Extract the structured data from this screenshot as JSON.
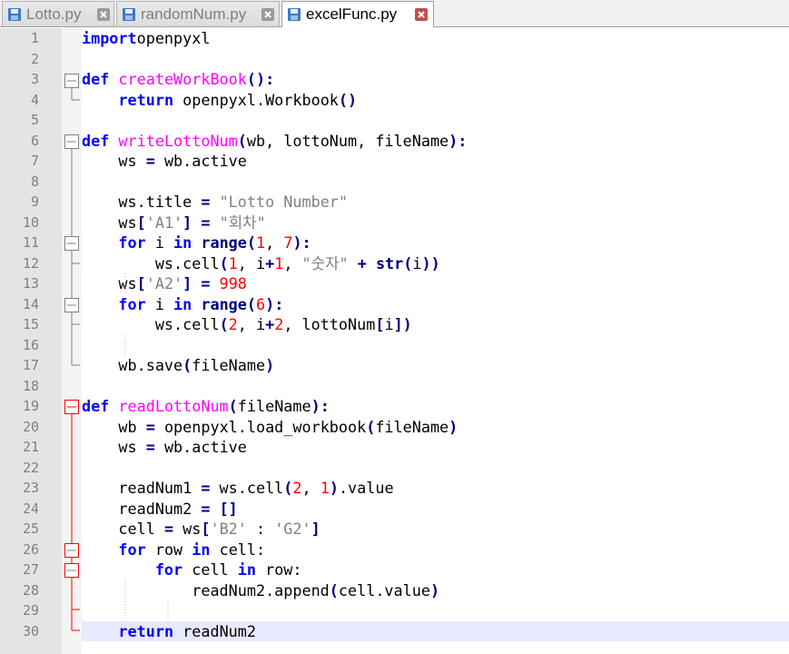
{
  "tabs": [
    {
      "label": "Lotto.py",
      "active": false
    },
    {
      "label": "randomNum.py",
      "active": false
    },
    {
      "label": "excelFunc.py",
      "active": true
    }
  ],
  "colors": {
    "keyword": "#0000ff",
    "function_name": "#ff00ff",
    "builtin": "#000080",
    "number": "#ff0000",
    "string": "#808080",
    "fold_active": "#ff0000",
    "current_line": "#e8e8ff"
  },
  "icons": {
    "tab_save": "floppy-disk-icon",
    "tab_close": "close-icon"
  },
  "editor": {
    "current_line": 30,
    "lines": [
      {
        "n": "1",
        "tokens": [
          [
            "kw",
            "import"
          ],
          [
            "",
            "openpyxl"
          ]
        ]
      },
      {
        "n": "2",
        "tokens": []
      },
      {
        "n": "3",
        "tokens": [
          [
            "kw",
            "def"
          ],
          [
            "",
            " "
          ],
          [
            "fn",
            "createWorkBook"
          ],
          [
            "op",
            "():"
          ]
        ]
      },
      {
        "n": "4",
        "tokens": [
          [
            "",
            "    "
          ],
          [
            "kw",
            "return"
          ],
          [
            "",
            " openpyxl.Workbook"
          ],
          [
            "op",
            "()"
          ]
        ]
      },
      {
        "n": "5",
        "tokens": []
      },
      {
        "n": "6",
        "tokens": [
          [
            "kw",
            "def"
          ],
          [
            "",
            " "
          ],
          [
            "fn",
            "writeLottoNum"
          ],
          [
            "op",
            "("
          ],
          [
            "",
            "wb, lottoNum, fileName"
          ],
          [
            "op",
            "):"
          ]
        ]
      },
      {
        "n": "7",
        "tokens": [
          [
            "",
            "    ws "
          ],
          [
            "op",
            "="
          ],
          [
            "",
            " wb.active"
          ]
        ]
      },
      {
        "n": "8",
        "tokens": []
      },
      {
        "n": "9",
        "tokens": [
          [
            "",
            "    ws.title "
          ],
          [
            "op",
            "="
          ],
          [
            "",
            " "
          ],
          [
            "str",
            "\"Lotto Number\""
          ]
        ]
      },
      {
        "n": "10",
        "tokens": [
          [
            "",
            "    ws"
          ],
          [
            "op",
            "["
          ],
          [
            "str",
            "'A1'"
          ],
          [
            "op",
            "]"
          ],
          [
            "",
            " "
          ],
          [
            "op",
            "="
          ],
          [
            "",
            " "
          ],
          [
            "str",
            "\"회차\""
          ]
        ]
      },
      {
        "n": "11",
        "tokens": [
          [
            "",
            "    "
          ],
          [
            "kw",
            "for"
          ],
          [
            "",
            " i "
          ],
          [
            "kw",
            "in"
          ],
          [
            "",
            " "
          ],
          [
            "bi",
            "range"
          ],
          [
            "op",
            "("
          ],
          [
            "num",
            "1"
          ],
          [
            "",
            ", "
          ],
          [
            "num",
            "7"
          ],
          [
            "op",
            "):"
          ]
        ]
      },
      {
        "n": "12",
        "tokens": [
          [
            "",
            "        ws.cell"
          ],
          [
            "op",
            "("
          ],
          [
            "num",
            "1"
          ],
          [
            "",
            ", i"
          ],
          [
            "op",
            "+"
          ],
          [
            "num",
            "1"
          ],
          [
            "",
            ", "
          ],
          [
            "str",
            "\"숫자\""
          ],
          [
            "",
            " "
          ],
          [
            "op",
            "+"
          ],
          [
            "",
            " "
          ],
          [
            "bi",
            "str"
          ],
          [
            "op",
            "("
          ],
          [
            "",
            "i"
          ],
          [
            "op",
            "))"
          ]
        ]
      },
      {
        "n": "13",
        "tokens": [
          [
            "",
            "    ws"
          ],
          [
            "op",
            "["
          ],
          [
            "str",
            "'A2'"
          ],
          [
            "op",
            "]"
          ],
          [
            "",
            " "
          ],
          [
            "op",
            "="
          ],
          [
            "",
            " "
          ],
          [
            "num",
            "998"
          ]
        ]
      },
      {
        "n": "14",
        "tokens": [
          [
            "",
            "    "
          ],
          [
            "kw",
            "for"
          ],
          [
            "",
            " i "
          ],
          [
            "kw",
            "in"
          ],
          [
            "",
            " "
          ],
          [
            "bi",
            "range"
          ],
          [
            "op",
            "("
          ],
          [
            "num",
            "6"
          ],
          [
            "op",
            "):"
          ]
        ]
      },
      {
        "n": "15",
        "tokens": [
          [
            "",
            "        ws.cell"
          ],
          [
            "op",
            "("
          ],
          [
            "num",
            "2"
          ],
          [
            "",
            ", i"
          ],
          [
            "op",
            "+"
          ],
          [
            "num",
            "2"
          ],
          [
            "",
            ", lottoNum"
          ],
          [
            "op",
            "["
          ],
          [
            "",
            "i"
          ],
          [
            "op",
            "])"
          ]
        ]
      },
      {
        "n": "16",
        "tokens": []
      },
      {
        "n": "17",
        "tokens": [
          [
            "",
            "    wb.save"
          ],
          [
            "op",
            "("
          ],
          [
            "",
            "fileName"
          ],
          [
            "op",
            ")"
          ]
        ]
      },
      {
        "n": "18",
        "tokens": []
      },
      {
        "n": "19",
        "tokens": [
          [
            "kw",
            "def"
          ],
          [
            "",
            " "
          ],
          [
            "fn",
            "readLottoNum"
          ],
          [
            "op",
            "("
          ],
          [
            "",
            "fileName"
          ],
          [
            "op",
            "):"
          ]
        ]
      },
      {
        "n": "20",
        "tokens": [
          [
            "",
            "    wb "
          ],
          [
            "op",
            "="
          ],
          [
            "",
            " openpyxl.load_workbook"
          ],
          [
            "op",
            "("
          ],
          [
            "",
            "fileName"
          ],
          [
            "op",
            ")"
          ]
        ]
      },
      {
        "n": "21",
        "tokens": [
          [
            "",
            "    ws "
          ],
          [
            "op",
            "="
          ],
          [
            "",
            " wb.active"
          ]
        ]
      },
      {
        "n": "22",
        "tokens": []
      },
      {
        "n": "23",
        "tokens": [
          [
            "",
            "    readNum1 "
          ],
          [
            "op",
            "="
          ],
          [
            "",
            " ws.cell"
          ],
          [
            "op",
            "("
          ],
          [
            "num",
            "2"
          ],
          [
            "",
            ", "
          ],
          [
            "num",
            "1"
          ],
          [
            "op",
            ")"
          ],
          [
            "",
            ".value"
          ]
        ]
      },
      {
        "n": "24",
        "tokens": [
          [
            "",
            "    readNum2 "
          ],
          [
            "op",
            "="
          ],
          [
            "",
            " "
          ],
          [
            "op",
            "[]"
          ]
        ]
      },
      {
        "n": "25",
        "tokens": [
          [
            "",
            "    cell "
          ],
          [
            "op",
            "="
          ],
          [
            "",
            " ws"
          ],
          [
            "op",
            "["
          ],
          [
            "str",
            "'B2'"
          ],
          [
            "",
            " : "
          ],
          [
            "str",
            "'G2'"
          ],
          [
            "op",
            "]"
          ]
        ]
      },
      {
        "n": "26",
        "tokens": [
          [
            "",
            "    "
          ],
          [
            "kw",
            "for"
          ],
          [
            "",
            " row "
          ],
          [
            "kw",
            "in"
          ],
          [
            "",
            " cell:"
          ]
        ]
      },
      {
        "n": "27",
        "tokens": [
          [
            "",
            "        "
          ],
          [
            "kw",
            "for"
          ],
          [
            "",
            " cell "
          ],
          [
            "kw",
            "in"
          ],
          [
            "",
            " row:"
          ]
        ]
      },
      {
        "n": "28",
        "tokens": [
          [
            "",
            "            readNum2.append"
          ],
          [
            "op",
            "("
          ],
          [
            "",
            "cell.value"
          ],
          [
            "op",
            ")"
          ]
        ]
      },
      {
        "n": "29",
        "tokens": []
      },
      {
        "n": "30",
        "tokens": [
          [
            "",
            "    "
          ],
          [
            "kw",
            "return"
          ],
          [
            "",
            " readNum2"
          ]
        ]
      }
    ]
  }
}
